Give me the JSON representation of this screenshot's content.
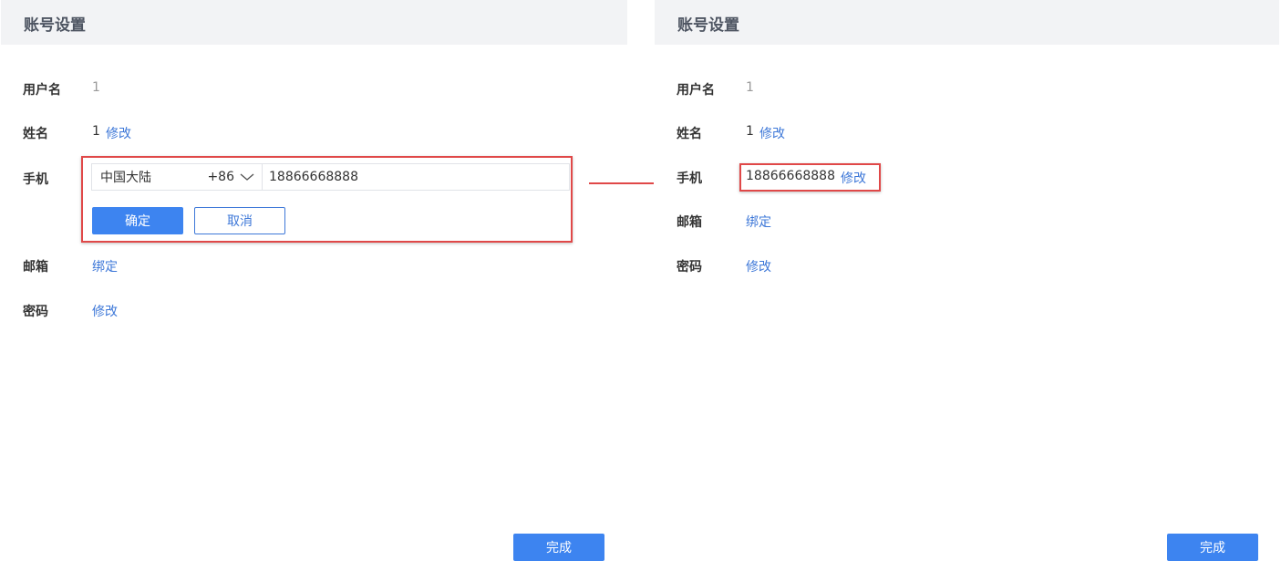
{
  "colors": {
    "header_bg": "#f2f3f5",
    "link": "#3e78d8",
    "primary": "#3d84f0",
    "highlight": "#e04848"
  },
  "left": {
    "title": "账号设置",
    "username": {
      "label": "用户名",
      "value": "1"
    },
    "name": {
      "label": "姓名",
      "value": "1",
      "action": "修改"
    },
    "phone": {
      "label": "手机",
      "region_name": "中国大陆",
      "region_code": "+86",
      "value": "18866668888",
      "confirm_label": "确定",
      "cancel_label": "取消"
    },
    "email": {
      "label": "邮箱",
      "action": "绑定"
    },
    "password": {
      "label": "密码",
      "action": "修改"
    },
    "done_label": "完成"
  },
  "right": {
    "title": "账号设置",
    "username": {
      "label": "用户名",
      "value": "1"
    },
    "name": {
      "label": "姓名",
      "value": "1",
      "action": "修改"
    },
    "phone": {
      "label": "手机",
      "value": "18866668888",
      "action": "修改"
    },
    "email": {
      "label": "邮箱",
      "action": "绑定"
    },
    "password": {
      "label": "密码",
      "action": "修改"
    },
    "done_label": "完成"
  }
}
